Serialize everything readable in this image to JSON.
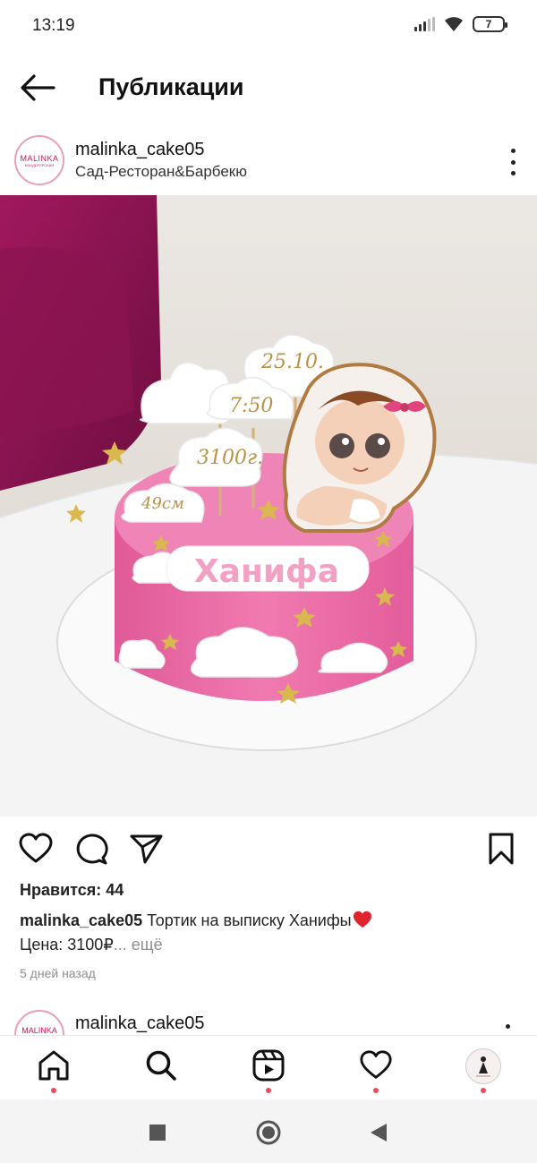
{
  "status_bar": {
    "time": "13:19",
    "battery": "7"
  },
  "header": {
    "title": "Публикации"
  },
  "post": {
    "username": "malinka_cake05",
    "location": "Сад-Ресторан&Барбекю",
    "avatar_text": "MALINKA",
    "avatar_subtext": "КОНДИТЕРСКАЯ",
    "photo": {
      "clouds": [
        "25.10.",
        "7:50",
        "3100г.",
        "49см"
      ],
      "cake_name": "Ханифа"
    },
    "likes": "Нравится: 44",
    "caption_username": "malinka_cake05",
    "caption_text": "Тортик на выписку Ханифы",
    "caption_line2": "Цена: 3100₽",
    "caption_more": "... ещё",
    "time_ago": "5 дней назад"
  },
  "next_post": {
    "username": "malinka_cake05",
    "avatar_text": "MALINKA"
  },
  "colors": {
    "accent_red": "#ed4956",
    "cake_pink": "#ea6aa3",
    "avatar_ring": "#e6a0b8",
    "text_muted": "#8e8e8e"
  },
  "icons": {
    "back": "arrow-left-icon",
    "more": "more-vertical-icon",
    "like": "heart-outline-icon",
    "comment": "comment-icon",
    "share": "send-icon",
    "save": "bookmark-icon",
    "nav": [
      "home-icon",
      "search-icon",
      "reels-icon",
      "activity-heart-icon",
      "profile-avatar"
    ]
  }
}
